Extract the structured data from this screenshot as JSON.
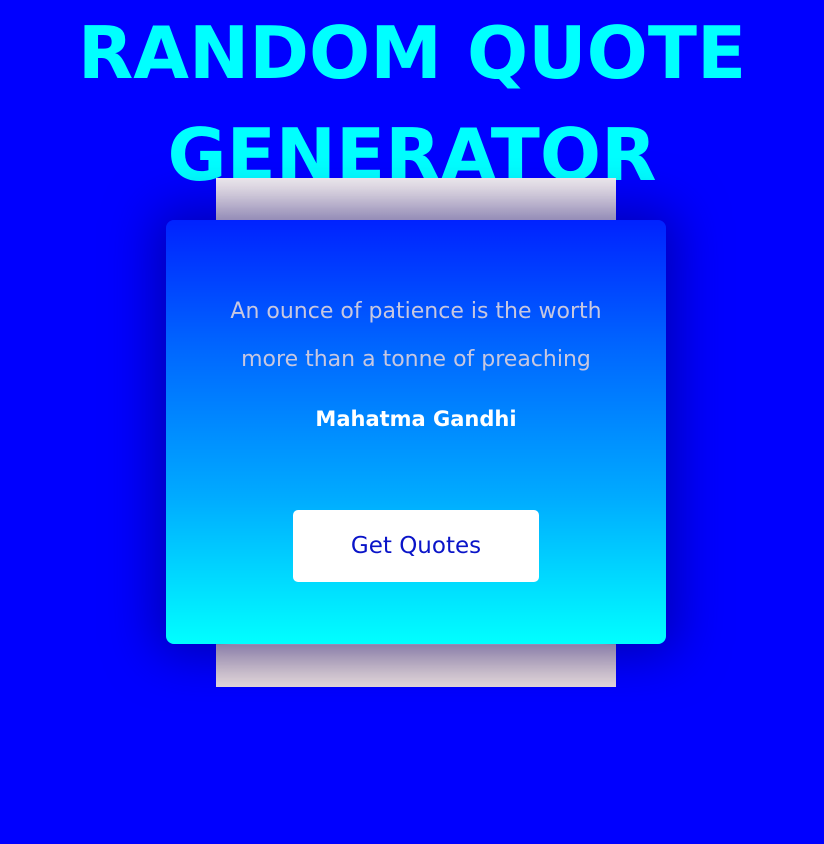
{
  "header": {
    "title": "RANDOM QUOTE GENERATOR"
  },
  "quote": {
    "text": "An ounce of patience is the worth more than a tonne of preaching",
    "author": "Mahatma Gandhi"
  },
  "actions": {
    "get_quotes_label": "Get Quotes"
  },
  "colors": {
    "background": "#0000ff",
    "title": "#00ffff",
    "card_gradient_top": "#0022ff",
    "card_gradient_bottom": "#00ffff",
    "button_background": "#ffffff",
    "button_text": "#0a14c8",
    "paper": "#f3eded"
  }
}
